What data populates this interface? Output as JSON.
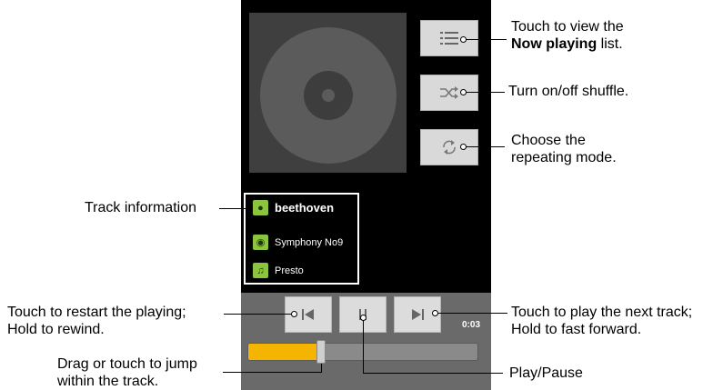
{
  "player": {
    "track": {
      "artist": "beethoven",
      "album": "Symphony No9",
      "title": "Presto"
    },
    "elapsed": "0:03",
    "progress": 0.31
  },
  "callouts": {
    "now_playing_1": "Touch to view the",
    "now_playing_bold": "Now playing",
    "now_playing_tail": " list.",
    "shuffle": "Turn on/off shuffle.",
    "repeat_1": "Choose the",
    "repeat_2": "repeating mode.",
    "track_info": "Track information",
    "restart_1": "Touch to restart the playing;",
    "restart_2": "Hold to rewind.",
    "next_1": "Touch to play the next track;",
    "next_2": "Hold to fast forward.",
    "drag_1": "Drag or touch to jump",
    "drag_2": "within the track.",
    "playpause": "Play/Pause"
  },
  "icons": {
    "list": "list-icon",
    "shuffle": "shuffle-icon",
    "repeat": "repeat-icon",
    "prev": "previous-track-icon",
    "pause": "pause-icon",
    "next": "next-track-icon"
  },
  "colors": {
    "progress_fill": "#f4b400",
    "info_icon": "#8bc53f"
  }
}
